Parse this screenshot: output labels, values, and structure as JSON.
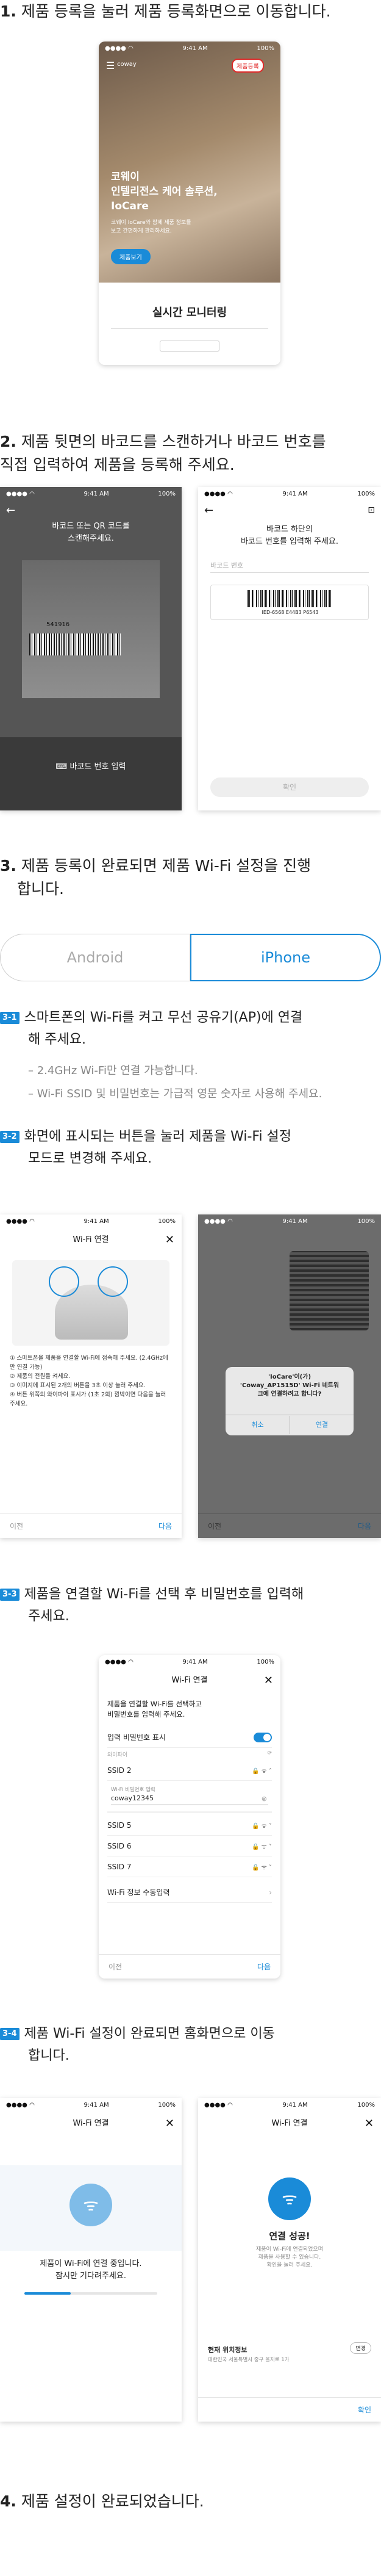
{
  "steps": {
    "s1": {
      "num": "1.",
      "text": "제품 등록을 눌러 제품 등록화면으로 이동합니다."
    },
    "s2": {
      "num": "2.",
      "line1": "제품 뒷면의 바코드를 스캔하거나 바코드 번호를",
      "line2": "직접 입력하여 제품을 등록해 주세요."
    },
    "s3": {
      "num": "3.",
      "line1": "제품 등록이 완료되면 제품 Wi-Fi 설정을 진행",
      "line2": "합니다."
    },
    "s4": {
      "num": "4.",
      "text": "제품 설정이 완료되었습니다."
    }
  },
  "tabs": {
    "android": "Android",
    "iphone": "iPhone"
  },
  "substeps": {
    "s31": {
      "badge": "3-1",
      "line1": "스마트폰의 Wi-Fi를 켜고 무선 공유기(AP)에 연결",
      "line2": "해 주세요.",
      "note1": "–  2.4GHz Wi-Fi만 연결 가능합니다.",
      "note2": "–  Wi-Fi SSID 및 비밀번호는 가급적 영문 숫자로 사용해 주세요."
    },
    "s32": {
      "badge": "3-2",
      "line1": "화면에 표시되는 버튼을 눌러 제품을 Wi-Fi 설정",
      "line2": "모드로 변경해 주세요."
    },
    "s33": {
      "badge": "3-3",
      "line1": "제품을 연결할 Wi-Fi를 선택 후 비밀번호를 입력해",
      "line2": "주세요."
    },
    "s34": {
      "badge": "3-4",
      "line1": "제품 Wi-Fi 설정이 완료되면 홈화면으로 이동",
      "line2": "합니다."
    }
  },
  "status": {
    "time": "9:41 AM",
    "battery": "100%"
  },
  "home": {
    "reg_btn": "제품등록",
    "brand": "코웨이",
    "headline1": "인텔리전스 케어 솔루션,",
    "headline2": "IoCare",
    "desc1": "코웨이 IoCare와 함께 제품 정보를",
    "desc2": "보고 간편하게 관리하세요.",
    "cta": "제품보기",
    "section": "실시간 모니터링"
  },
  "scan": {
    "guide1": "바코드 또는 QR 코드를",
    "guide2": "스캔해주세요.",
    "barcode_num": "541916",
    "manual": "바코드 번호 입력"
  },
  "input": {
    "title1": "바코드 하단의",
    "title2": "바코드 번호를 입력해 주세요.",
    "placeholder": "바코드 번호",
    "barcode_text": "IED-6568 E44B3 P6543",
    "confirm": "확인"
  },
  "wifi": {
    "title": "Wi-Fi 연결",
    "list": [
      "스마트폰을 제품을 연결할 Wi-Fi에 접속해 주세요. (2.4GHz에만 연결 가능)",
      "제품의 전원을 켜세요.",
      "이미지에 표시된 2개의 버튼을 3초 이상 눌러 주세요.",
      "버튼 위쪽의 와이파이 표시가 (1초 2회) 깜박이면 다음을 눌러 주세요."
    ],
    "prev": "이전",
    "next": "다음",
    "dialog_title1": "'IoCare'이(가)",
    "dialog_title2": "'Coway_AP1515D' Wi-Fi 네트워",
    "dialog_title3": "크에 연결하려고 합니다?",
    "cancel": "취소",
    "join": "연결"
  },
  "select": {
    "desc1": "제품을 연결할 Wi-Fi를 선택하고",
    "desc2": "비밀번호를 입력해 주세요.",
    "show_pw": "입력 비밀번호 표시",
    "ssid_label": "와이파이",
    "ssid2": "SSID 2",
    "pw_label": "Wi-Fi 비밀번호 입력",
    "pw_value": "coway12345",
    "ssids": [
      "SSID 5",
      "SSID 6",
      "SSID 7"
    ],
    "manual": "Wi-Fi 정보 수동입력"
  },
  "connecting": {
    "title": "Wi-Fi 연결",
    "msg1": "제품이 Wi-Fi에 연결 중입니다.",
    "msg2": "잠시만 기다려주세요.",
    "progress": 0.35
  },
  "success": {
    "title": "Wi-Fi 연결",
    "msg": "연결 성공!",
    "sub1": "제품이 Wi-Fi에 연결되었으며",
    "sub2": "제품을 사용할 수 있습니다.",
    "sub3": "확인을 눌러 주세요.",
    "loc_label": "현재 위치정보",
    "loc_btn": "변경",
    "loc_desc": "대한민국 서울특별시 중구 을지로 1가",
    "confirm": "확인"
  },
  "colors": {
    "accent": "#1a8bd8",
    "red": "#e02a2a"
  }
}
